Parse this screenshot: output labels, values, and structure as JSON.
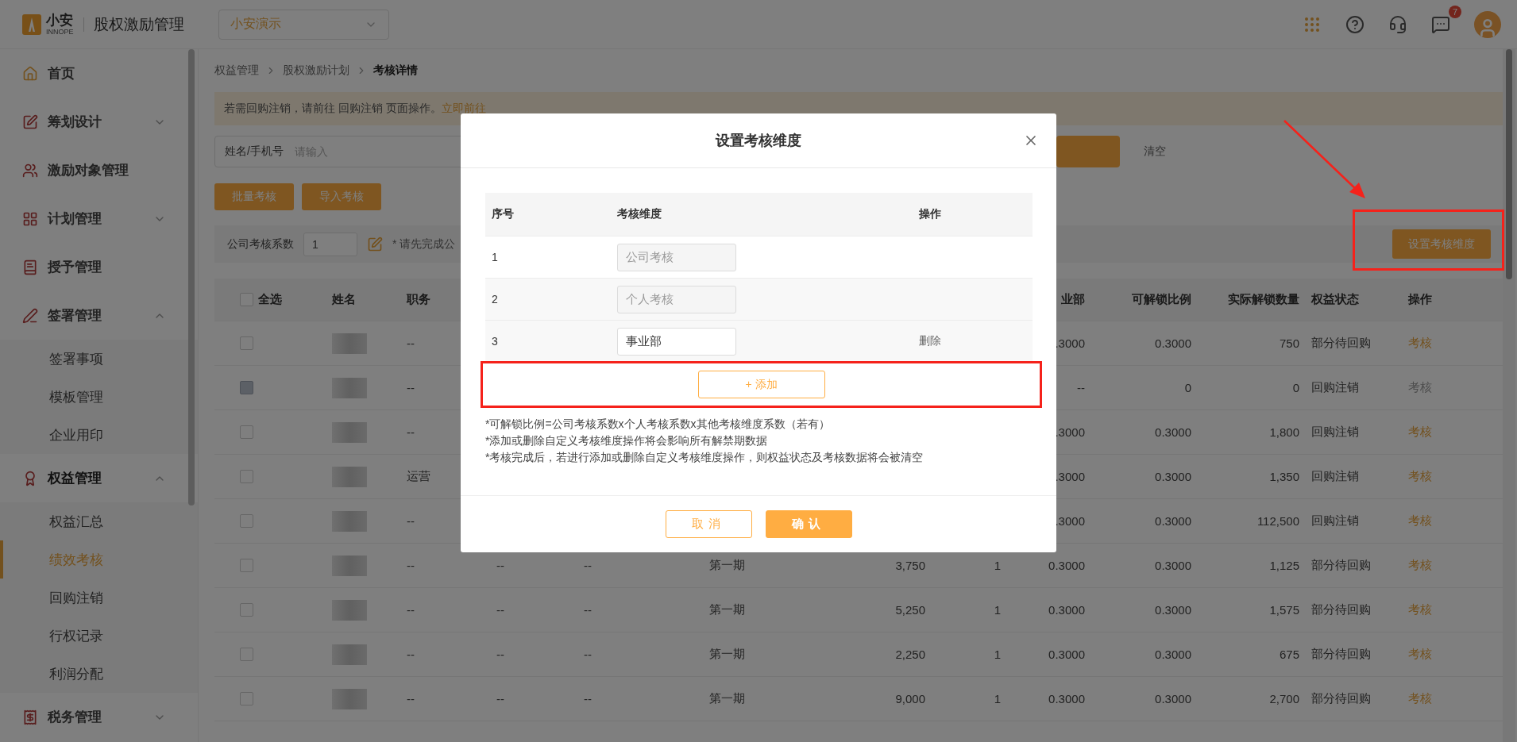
{
  "header": {
    "logo": {
      "name": "小安",
      "tagline": "INNOPE"
    },
    "title": "股权激励管理",
    "org_select": {
      "value": "小安演示"
    },
    "messages": {
      "badge": "7"
    }
  },
  "sidebar": {
    "items": [
      {
        "kind": "link",
        "label": "首页",
        "selected": false
      },
      {
        "kind": "group",
        "label": "筹划设计",
        "expanded": false
      },
      {
        "kind": "link",
        "label": "激励对象管理",
        "selected": false
      },
      {
        "kind": "group",
        "label": "计划管理",
        "expanded": false
      },
      {
        "kind": "link",
        "label": "授予管理",
        "selected": false
      },
      {
        "kind": "group",
        "label": "签署管理",
        "expanded": true,
        "children": [
          {
            "label": "签署事项",
            "selected": false
          },
          {
            "label": "模板管理",
            "selected": false
          },
          {
            "label": "企业用印",
            "selected": false
          }
        ]
      },
      {
        "kind": "group",
        "label": "权益管理",
        "expanded": true,
        "children": [
          {
            "label": "权益汇总",
            "selected": false
          },
          {
            "label": "绩效考核",
            "selected": true
          },
          {
            "label": "回购注销",
            "selected": false
          },
          {
            "label": "行权记录",
            "selected": false
          },
          {
            "label": "利润分配",
            "selected": false
          }
        ]
      },
      {
        "kind": "group",
        "label": "税务管理",
        "expanded": false
      }
    ]
  },
  "breadcrumb": [
    "权益管理",
    "股权激励计划",
    "考核详情"
  ],
  "notice": {
    "text": "若需回购注销，请前往 回购注销 页面操作。",
    "link": "立即前往"
  },
  "filters": {
    "field": {
      "label": "姓名/手机号",
      "placeholder": "请输入"
    },
    "clear_button": "清空"
  },
  "actions": [
    "批量考核",
    "导入考核"
  ],
  "coefficient": {
    "label": "公司考核系数",
    "value": "1",
    "hint": "* 请先完成公"
  },
  "dimension_button": "设置考核维度",
  "table": {
    "header": {
      "select_all": {
        "label": "全选",
        "checked": false
      },
      "name": "姓名",
      "position": "职务",
      "business_unit": "业部",
      "unlock_ratio": "可解锁比例",
      "actual_unlock": "实际解锁数量",
      "status": "权益状态",
      "action": "操作"
    },
    "rows": [
      {
        "checked": false,
        "disabled": false,
        "position": "--",
        "business_unit": ".3000",
        "unlock_ratio": "0.3000",
        "actual_unlock": "750",
        "status": "部分待回购",
        "action": {
          "label": "考核",
          "disabled": false
        }
      },
      {
        "checked": false,
        "disabled": true,
        "position": "--",
        "business_unit": "--",
        "unlock_ratio": "0",
        "actual_unlock": "0",
        "status": "回购注销",
        "action": {
          "label": "考核",
          "disabled": true
        }
      },
      {
        "checked": false,
        "disabled": false,
        "position": "--",
        "business_unit": ".3000",
        "unlock_ratio": "0.3000",
        "actual_unlock": "1,800",
        "status": "回购注销",
        "action": {
          "label": "考核",
          "disabled": false
        }
      },
      {
        "checked": false,
        "disabled": false,
        "position": "运营",
        "business_unit": ".3000",
        "unlock_ratio": "0.3000",
        "actual_unlock": "1,350",
        "status": "回购注销",
        "action": {
          "label": "考核",
          "disabled": false
        }
      },
      {
        "checked": false,
        "disabled": false,
        "position": "--",
        "business_unit": ".3000",
        "unlock_ratio": "0.3000",
        "actual_unlock": "112,500",
        "status": "回购注销",
        "action": {
          "label": "考核",
          "disabled": false
        }
      },
      {
        "checked": false,
        "disabled": false,
        "position": "--",
        "column_4": "--",
        "column_5": "--",
        "period": "第一期",
        "column_7": "3,750",
        "column_8": "1",
        "business_unit": "0.3000",
        "unlock_ratio": "0.3000",
        "actual_unlock": "1,125",
        "status": "部分待回购",
        "action": {
          "label": "考核",
          "disabled": false
        }
      },
      {
        "checked": false,
        "disabled": false,
        "position": "--",
        "column_4": "--",
        "column_5": "--",
        "period": "第一期",
        "column_7": "5,250",
        "column_8": "1",
        "business_unit": "0.3000",
        "unlock_ratio": "0.3000",
        "actual_unlock": "1,575",
        "status": "部分待回购",
        "action": {
          "label": "考核",
          "disabled": false
        }
      },
      {
        "checked": false,
        "disabled": false,
        "position": "--",
        "column_4": "--",
        "column_5": "--",
        "period": "第一期",
        "column_7": "2,250",
        "column_8": "1",
        "business_unit": "0.3000",
        "unlock_ratio": "0.3000",
        "actual_unlock": "675",
        "status": "部分待回购",
        "action": {
          "label": "考核",
          "disabled": false
        }
      },
      {
        "checked": false,
        "disabled": false,
        "position": "--",
        "column_4": "--",
        "column_5": "--",
        "period": "第一期",
        "column_7": "9,000",
        "column_8": "1",
        "business_unit": "0.3000",
        "unlock_ratio": "0.3000",
        "actual_unlock": "2,700",
        "status": "部分待回购",
        "action": {
          "label": "考核",
          "disabled": false
        }
      }
    ]
  },
  "modal": {
    "title": "设置考核维度",
    "columns": [
      "序号",
      "考核维度",
      "操作"
    ],
    "rows": [
      {
        "index": "1",
        "value": "公司考核",
        "disabled": true
      },
      {
        "index": "2",
        "value": "个人考核",
        "disabled": true
      },
      {
        "index": "3",
        "value": "事业部",
        "disabled": false,
        "action": "删除"
      }
    ],
    "add_button": "+ 添加",
    "notes": [
      "*可解锁比例=公司考核系数x个人考核系数x其他考核维度系数（若有）",
      "*添加或删除自定义考核维度操作将会影响所有解禁期数据",
      "*考核完成后，若进行添加或删除自定义考核维度操作，则权益状态及考核数据将会被清空"
    ],
    "cancel_button": "取消",
    "confirm_button": "确认"
  }
}
